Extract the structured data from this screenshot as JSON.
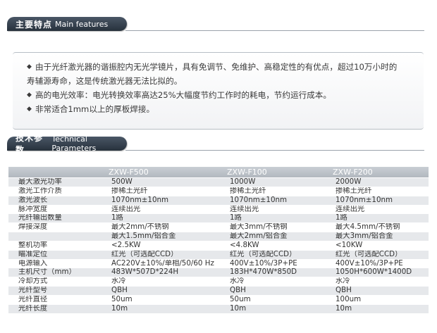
{
  "features_header": {
    "cn": "主要特点",
    "en": "Main features"
  },
  "features": [
    "由于光纤激光器的谐振腔内无光学镜片，具有免调节、免维护、高稳定性的有优点，超过10万小时的",
    "寿辅源寿命，这是传统激光器无法比拟的。",
    "高的电光效率：电光转换效率高达25%大幅度节约工作时的耗电，节约运行成本。",
    "非常适合1mm以上的厚板焊接。"
  ],
  "params_header": {
    "cn": "技术参数",
    "en": "Technical Parameters"
  },
  "table": {
    "columns": [
      "ZXW-F500",
      "ZXW-F100",
      "ZXW-F200"
    ],
    "rows": [
      {
        "label": "最大激光功率",
        "values": [
          "500W",
          "1000W",
          "2000W"
        ]
      },
      {
        "label": "激光工作介质",
        "values": [
          "掺稀土光纤",
          "掺稀土光纤",
          "掺稀土光纤"
        ]
      },
      {
        "label": "激光波长",
        "values": [
          "1070nm±10nm",
          "1070nm±10nm",
          "1070nm±10nm"
        ]
      },
      {
        "label": "脉冲宽度",
        "values": [
          "连续出光",
          "连续出光",
          "连续出光"
        ]
      },
      {
        "label": "光纤输出数量",
        "values": [
          "1路",
          "1路",
          "1路"
        ]
      },
      {
        "label": "焊接深度",
        "values": [
          "最大2mm/不锈钢",
          "最大3mm/不锈钢",
          "最大4.5mm/不锈钢"
        ]
      },
      {
        "label": "",
        "values": [
          "最大1.5mm/铝合金",
          "最大2mm/铝合金",
          "最大3mm/铝合金"
        ]
      },
      {
        "label": "整机功率",
        "values": [
          "<2.5KW",
          "<4.8KW",
          "<10KW"
        ]
      },
      {
        "label": "瞄准定位",
        "values": [
          "红光（可选配CCD）",
          "红光（可选配CCD）",
          "红光（可选配CCD）"
        ]
      },
      {
        "label": "电源输入",
        "values": [
          "AC220V±10%/单相/50/60 Hz",
          "400V±10%/3P+PE",
          "400V±10%/3P+PE"
        ]
      },
      {
        "label": "主机尺寸（mm）",
        "values": [
          "483W*507D*224H",
          "183H*470W*850D",
          "1050H*600W*1400D"
        ]
      },
      {
        "label": "冷却方式",
        "values": [
          "水冷",
          "水冷",
          "水冷"
        ]
      },
      {
        "label": "光纤型号",
        "values": [
          "QBH",
          "QBH",
          "QBH"
        ]
      },
      {
        "label": "光纤直径",
        "values": [
          "50um",
          "50um",
          "100um"
        ]
      },
      {
        "label": "光纤长度",
        "values": [
          "10m",
          "10m",
          "10m"
        ]
      }
    ]
  }
}
